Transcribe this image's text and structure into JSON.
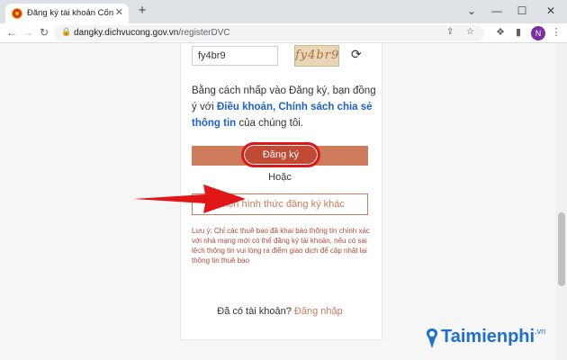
{
  "browser": {
    "tab_title": "Đăng ký tài khoản Cổng DVC qu",
    "tab_close": "✕",
    "new_tab": "+",
    "window_controls": [
      "⌄",
      "—",
      "☐",
      "✕"
    ],
    "url_host": "dangky.dichvucong.gov.vn",
    "url_path": "/registerDVC",
    "profile_initial": "N",
    "icons": [
      "back-icon",
      "forward-icon",
      "reload-icon",
      "lock-icon",
      "share-icon",
      "bookmark-star-icon",
      "extensions-icon",
      "sidebar-icon",
      "menu-icon"
    ]
  },
  "form": {
    "captcha_value": "fy4br9",
    "captcha_image_text": "fy4br9",
    "agree_prefix": "Bằng cách nhấp vào Đăng ký, bạn đồng ý với ",
    "agree_link": "Điều khoản, Chính sách chia sẻ thông tin",
    "agree_suffix": " của chúng tôi.",
    "register_label": "Đăng ký",
    "or_label": "Hoặc",
    "alt_register_label": "Chọn hình thức đăng ký khác",
    "note": "Lưu ý: Chỉ các thuê bao đã khai báo thông tin chính xác với nhà mạng mới có thể đăng ký tài khoản, nếu có sai lệch thông tin vui lòng ra điểm giao dịch để cập nhật lại thông tin thuê bao",
    "have_account": "Đã có tài khoản? ",
    "login_label": "Đăng nhập"
  },
  "watermark": {
    "text": "Taimienphi",
    "suffix": ".vn"
  },
  "colors": {
    "accent": "#cc7b5b",
    "link": "#1d60c8",
    "highlight": "#e21616",
    "arrow": "#e21616"
  }
}
